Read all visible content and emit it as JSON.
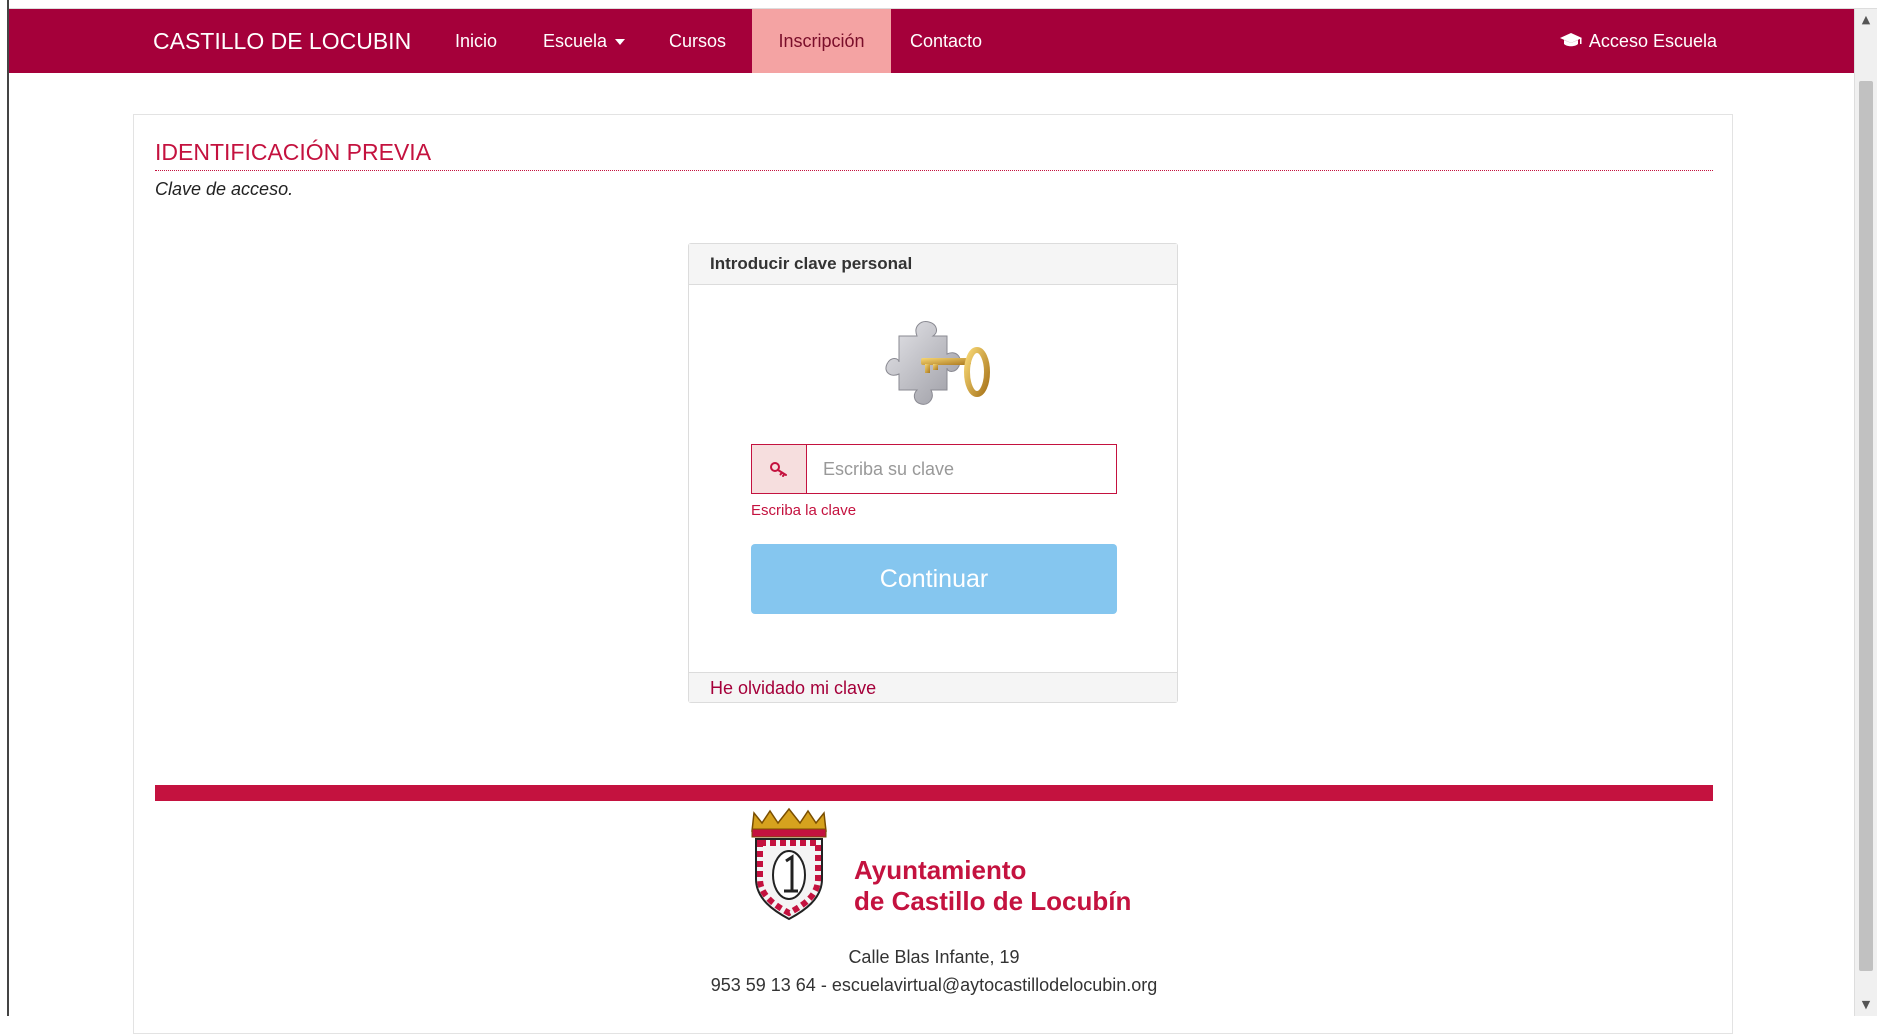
{
  "navbar": {
    "brand": "CASTILLO DE LOCUBIN",
    "items": [
      {
        "label": "Inicio"
      },
      {
        "label": "Escuela"
      },
      {
        "label": "Cursos"
      },
      {
        "label": "Inscripción",
        "active": true
      },
      {
        "label": "Contacto"
      }
    ],
    "access_label": "Acceso Escuela",
    "access_icon": "graduation-cap-icon"
  },
  "section": {
    "title": "IDENTIFICACIÓN PREVIA",
    "subtitle": "Clave de acceso."
  },
  "login": {
    "heading": "Introducir clave personal",
    "image": "puzzle-key-image",
    "input_icon": "key-icon",
    "placeholder": "Escriba su clave",
    "error": "Escriba la clave",
    "continue_label": "Continuar",
    "forgot_label": "He olvidado mi clave"
  },
  "footer": {
    "org_line1": "Ayuntamiento",
    "org_line2": "de Castillo de Locubín",
    "address": "Calle Blas Infante, 19",
    "contact": "953 59 13 64 - escuelavirtual@aytocastillodelocubin.org"
  },
  "colors": {
    "brand": "#a5003a",
    "accent": "#c4123f",
    "active_tab": "#f4a3a3",
    "button": "#85c6ef"
  }
}
